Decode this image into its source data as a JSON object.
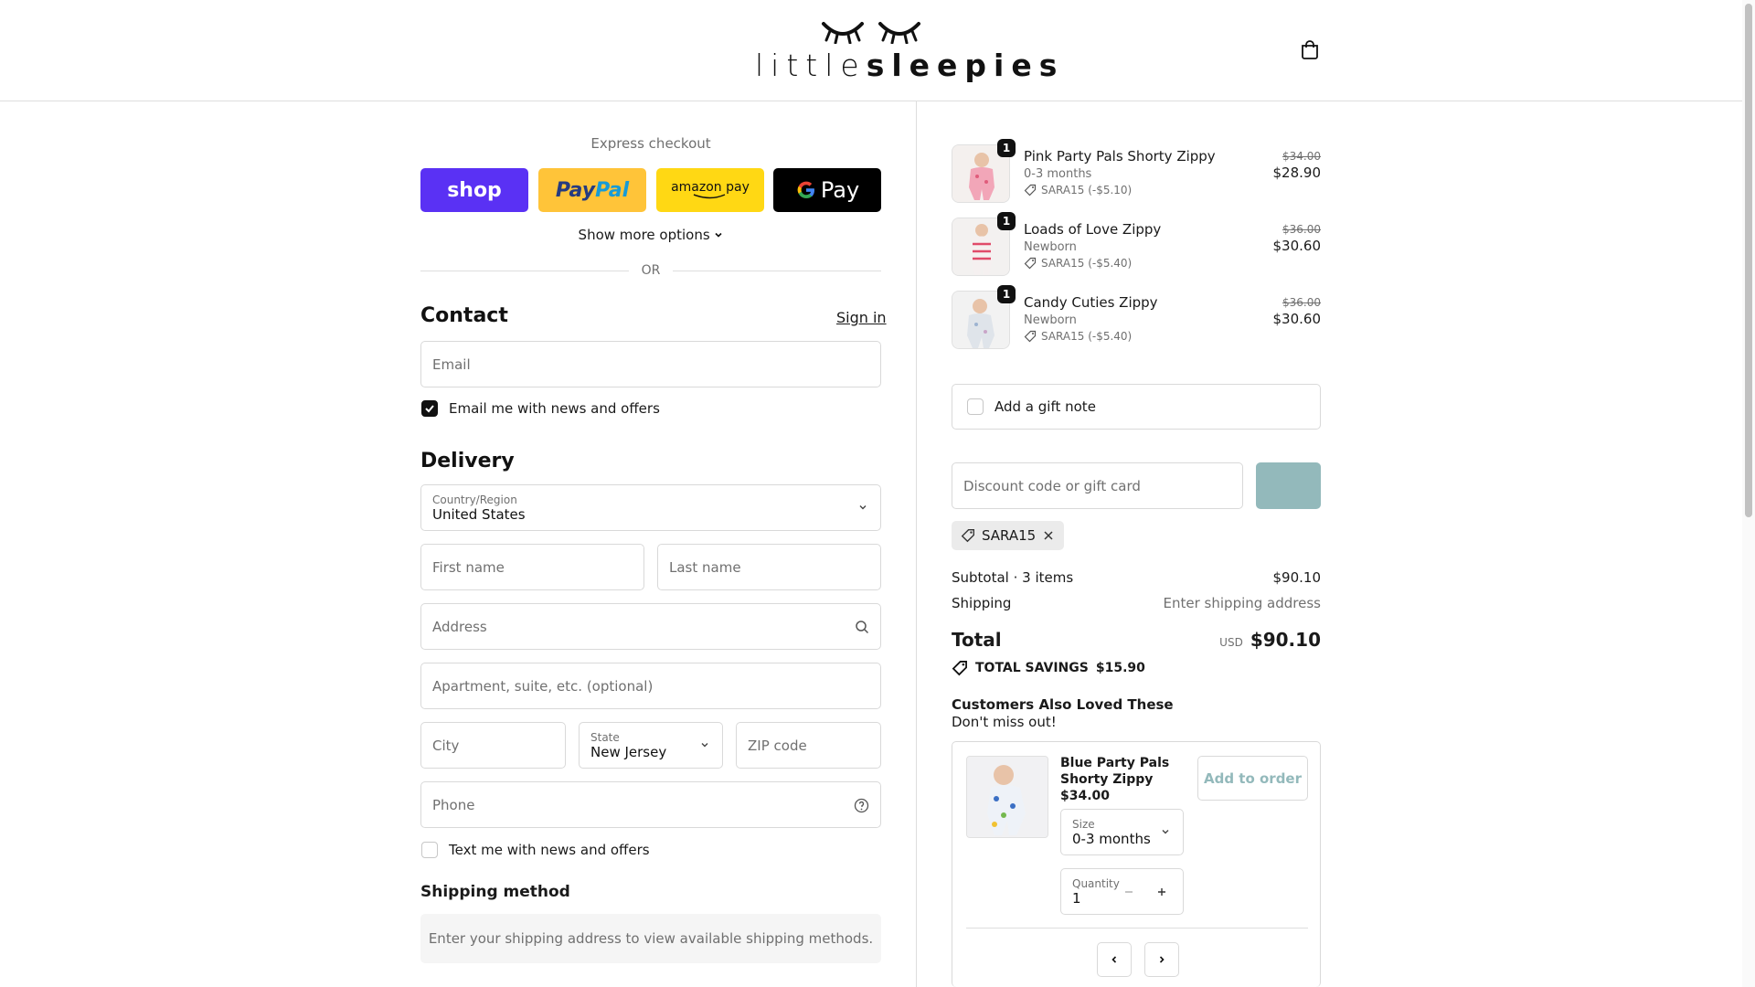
{
  "brand": {
    "logo_thin": "little",
    "logo_bold": "sleepies"
  },
  "express": {
    "title": "Express checkout",
    "shop": "shop",
    "paypal_a": "Pay",
    "paypal_b": "Pal",
    "amazon": "amazon pay",
    "gpay": "Pay",
    "show_more": "Show more options",
    "or": "OR"
  },
  "contact": {
    "heading": "Contact",
    "sign_in": "Sign in",
    "email_placeholder": "Email",
    "news_label": "Email me with news and offers",
    "news_checked": true
  },
  "delivery": {
    "heading": "Delivery",
    "country_label": "Country/Region",
    "country_value": "United States",
    "first_name": "First name",
    "last_name": "Last name",
    "address": "Address",
    "apartment": "Apartment, suite, etc. (optional)",
    "city": "City",
    "state_label": "State",
    "state_value": "New Jersey",
    "zip": "ZIP code",
    "phone": "Phone",
    "text_label": "Text me with news and offers",
    "text_checked": false
  },
  "shipping": {
    "heading": "Shipping method",
    "message": "Enter your shipping address to view available shipping methods."
  },
  "cart": {
    "items": [
      {
        "qty": "1",
        "name": "Pink Party Pals Shorty Zippy",
        "variant": "0-3 months",
        "discount": "SARA15 (-$5.10)",
        "old_price": "$34.00",
        "price": "$28.90"
      },
      {
        "qty": "1",
        "name": "Loads of Love Zippy",
        "variant": "Newborn",
        "discount": "SARA15 (-$5.40)",
        "old_price": "$36.00",
        "price": "$30.60"
      },
      {
        "qty": "1",
        "name": "Candy Cuties Zippy",
        "variant": "Newborn",
        "discount": "SARA15 (-$5.40)",
        "old_price": "$36.00",
        "price": "$30.60"
      }
    ],
    "gift_note": "Add a gift note",
    "discount_placeholder": "Discount code or gift card",
    "applied_code": "SARA15",
    "subtotal_label": "Subtotal · 3 items",
    "subtotal_value": "$90.10",
    "shipping_label": "Shipping",
    "shipping_value": "Enter shipping address",
    "total_label": "Total",
    "currency": "USD",
    "total_value": "$90.10",
    "savings_label": "TOTAL SAVINGS",
    "savings_value": "$15.90"
  },
  "upsell": {
    "title": "Customers Also Loved These",
    "subtitle": "Don't miss out!",
    "product_name": "Blue Party Pals Shorty Zippy",
    "product_price": "$34.00",
    "add_button": "Add to order",
    "size_label": "Size",
    "size_value": "0-3 months",
    "qty_label": "Quantity",
    "qty_value": "1"
  },
  "colors": {
    "shop": "#5a31f4",
    "paypal": "#ffc439",
    "amazon": "#ffd814",
    "gpay": "#000000",
    "apply": "#93b9bb"
  }
}
